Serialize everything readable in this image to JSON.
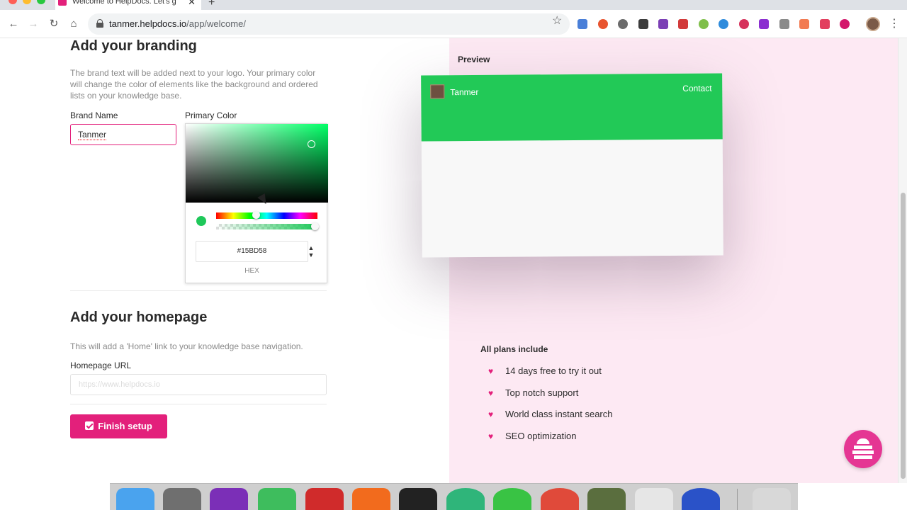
{
  "browser": {
    "tab_title": "Welcome to HelpDocs. Let's g",
    "tab_close": "✕",
    "new_tab": "+",
    "url_host": "tanmer.helpdocs.io",
    "url_path": "/app/welcome/",
    "nav": {
      "back": "←",
      "forward": "→",
      "reload": "↻",
      "home": "⌂",
      "star": "☆",
      "menu": "⋮"
    }
  },
  "branding": {
    "title": "Add your branding",
    "description": "The brand text will be added next to your logo. Your primary color will change the color of elements like the background and ordered lists on your knowledge base.",
    "brand_name_label": "Brand Name",
    "brand_name_value": "Tanmer",
    "primary_color_label": "Primary Color"
  },
  "color_picker": {
    "hex_value": "#15BD58",
    "hex_label": "HEX",
    "toggle_up": "▲",
    "toggle_down": "▼",
    "selected_color": "#1fc85a",
    "hue_color": "#00ff66"
  },
  "homepage": {
    "title": "Add your homepage",
    "description": "This will add a 'Home' link to your knowledge base navigation.",
    "url_label": "Homepage URL",
    "url_placeholder": "https://www.helpdocs.io"
  },
  "finish_button": "Finish setup",
  "preview": {
    "label": "Preview",
    "brand_name": "Tanmer",
    "contact": "Contact",
    "header_color": "#22c957"
  },
  "plans": {
    "title": "All plans include",
    "items": [
      "14 days free to try it out",
      "Top notch support",
      "World class instant search",
      "SEO optimization"
    ]
  },
  "colors": {
    "accent": "#e3207b",
    "panel": "#fde9f3"
  }
}
